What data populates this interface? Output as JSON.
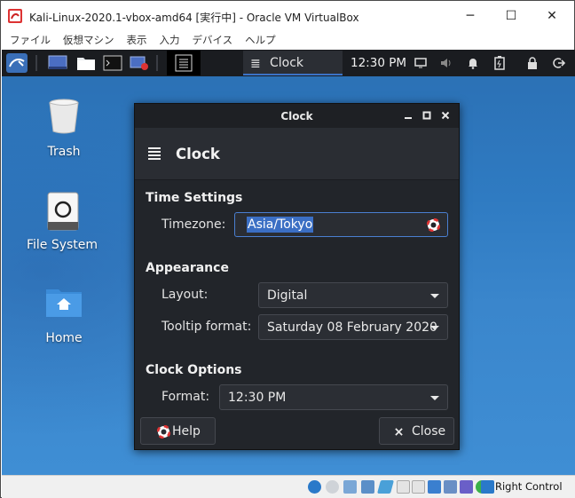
{
  "host_window": {
    "title": "Kali-Linux-2020.1-vbox-amd64 [実行中] - Oracle VM VirtualBox",
    "controls": {
      "minimize": "─",
      "maximize": "☐",
      "close": "✕"
    },
    "menu": [
      "ファイル",
      "仮想マシン",
      "表示",
      "入力",
      "デバイス",
      "ヘルプ"
    ]
  },
  "panel": {
    "active_task": "Clock",
    "time": "12:30 PM"
  },
  "desktop": {
    "icons": [
      {
        "label": "Trash",
        "icon": "trash-icon"
      },
      {
        "label": "File System",
        "icon": "drive-icon"
      },
      {
        "label": "Home",
        "icon": "home-folder-icon"
      }
    ]
  },
  "dialog": {
    "title": "Clock",
    "header": "Clock",
    "sections": {
      "time_settings": {
        "title": "Time Settings",
        "timezone_label": "Timezone:",
        "timezone_value": "Asia/Tokyo"
      },
      "appearance": {
        "title": "Appearance",
        "layout_label": "Layout:",
        "layout_value": "Digital",
        "tooltip_label": "Tooltip format:",
        "tooltip_value": "Saturday 08 February 2020"
      },
      "clock_options": {
        "title": "Clock Options",
        "format_label": "Format:",
        "format_value": "12:30 PM"
      }
    },
    "buttons": {
      "help": "Help",
      "close": "Close"
    }
  },
  "statusbar": {
    "host_key": "Right Control"
  },
  "colors": {
    "accent": "#3b6fc4",
    "dialog_bg": "#22252a",
    "panel_bg": "#1a1c20",
    "desktop_blue": "#2f7bc2"
  }
}
